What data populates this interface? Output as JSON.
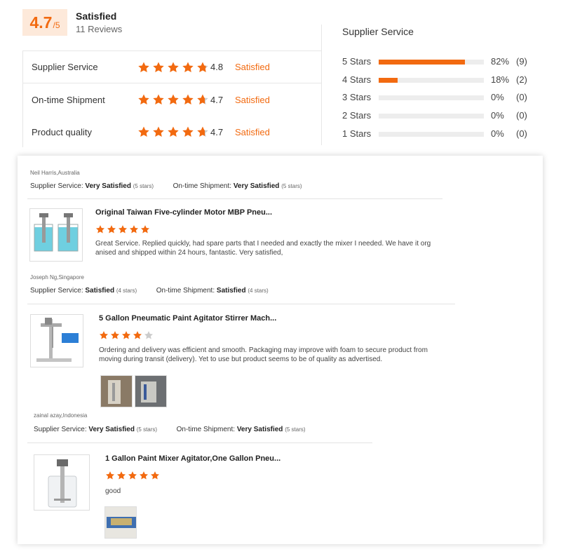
{
  "summary": {
    "score": "4.7",
    "score_max": "/5",
    "label": "Satisfied",
    "reviews": "11 Reviews"
  },
  "categories": [
    {
      "name": "Supplier Service",
      "value": "4.8",
      "status": "Satisfied",
      "stars": 4.8
    },
    {
      "name": "On-time Shipment",
      "value": "4.7",
      "status": "Satisfied",
      "stars": 4.7
    },
    {
      "name": "Product quality",
      "value": "4.7",
      "status": "Satisfied",
      "stars": 4.7
    }
  ],
  "distribution": {
    "title": "Supplier Service",
    "rows": [
      {
        "label": "5 Stars",
        "fraction": 0.82,
        "pct": "82%",
        "count": "(9)"
      },
      {
        "label": "4 Stars",
        "fraction": 0.18,
        "pct": "18%",
        "count": "(2)"
      },
      {
        "label": "3 Stars",
        "fraction": 0,
        "pct": "0%",
        "count": "(0)"
      },
      {
        "label": "2 Stars",
        "fraction": 0,
        "pct": "0%",
        "count": "(0)"
      },
      {
        "label": "1 Stars",
        "fraction": 0,
        "pct": "0%",
        "count": "(0)"
      }
    ]
  },
  "reviews": [
    {
      "author": "Neil Harris,Australia",
      "service_label": "Supplier Service:",
      "service_value": "Very Satisfied",
      "service_stars": "(5 stars)",
      "shipment_label": "On-time Shipment:",
      "shipment_value": "Very Satisfied",
      "shipment_stars": "(5 stars)",
      "product_title": "Original Taiwan Five-cylinder Motor MBP Pneu...",
      "rating": 5,
      "text": "Great Service. Replied quickly, had spare parts that I needed and exactly the mixer I needed. We have it org anised and shipped within 24 hours, fantastic. Very satisfied,"
    },
    {
      "author": "Joseph Ng,Singapore",
      "service_label": "Supplier Service:",
      "service_value": "Satisfied",
      "service_stars": "(4 stars)",
      "shipment_label": "On-time Shipment:",
      "shipment_value": "Satisfied",
      "shipment_stars": "(4 stars)",
      "product_title": "5 Gallon Pneumatic Paint Agitator Stirrer Mach...",
      "rating": 4,
      "text": "Ordering and delivery was efficient and smooth.  Packaging may improve with foam to secure product from moving during transit (delivery).  Yet to use but product seems to be of quality as advertised."
    },
    {
      "author": "zainal azay,Indonesia",
      "service_label": "Supplier Service:",
      "service_value": "Very Satisfied",
      "service_stars": "(5 stars)",
      "shipment_label": "On-time Shipment:",
      "shipment_value": "Very Satisfied",
      "shipment_stars": "(5 stars)",
      "product_title": "1 Gallon Paint Mixer Agitator,One Gallon Pneu...",
      "rating": 5,
      "text": "good"
    }
  ],
  "colors": {
    "accent": "#f26a10",
    "star_empty": "#cccccc",
    "track": "#ededed"
  },
  "icons": {
    "star": "star-icon"
  }
}
